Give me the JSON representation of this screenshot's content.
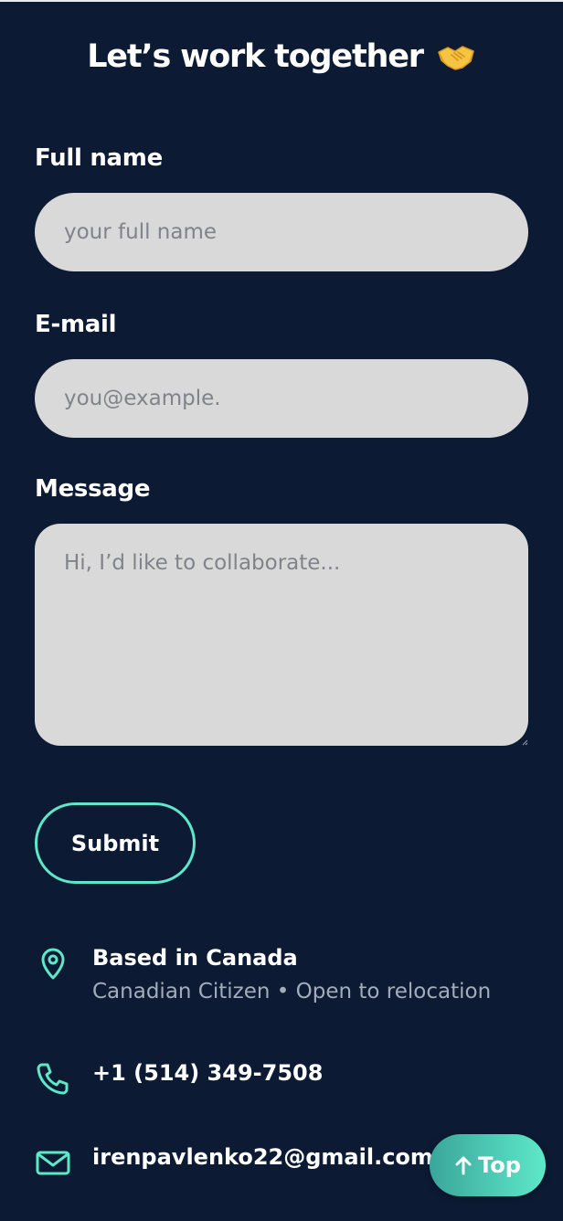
{
  "heading": {
    "title": "Let’s work together",
    "emoji_icon": "handshake-icon"
  },
  "form": {
    "full_name": {
      "label": "Full name",
      "placeholder": "your full name",
      "value": ""
    },
    "email": {
      "label": "E-mail",
      "placeholder": "you@example.",
      "value": ""
    },
    "message": {
      "label": "Message",
      "placeholder": "Hi, I’d like to collaborate...",
      "value": ""
    },
    "submit_label": "Submit"
  },
  "contact": {
    "location": {
      "icon": "location-pin-icon",
      "title": "Based in Canada",
      "subtitle": "Canadian Citizen • Open to relocation"
    },
    "phone": {
      "icon": "phone-icon",
      "text": "+1 (514) 349-7508"
    },
    "email": {
      "icon": "mail-icon",
      "text": "irenpavlenko22@gmail.com"
    }
  },
  "scroll_top": {
    "label": "Top",
    "icon": "arrow-up-icon"
  },
  "colors": {
    "background": "#0c1a33",
    "accent": "#5ee8c9",
    "field": "#d9d9d9",
    "muted_text": "#a3acba"
  }
}
